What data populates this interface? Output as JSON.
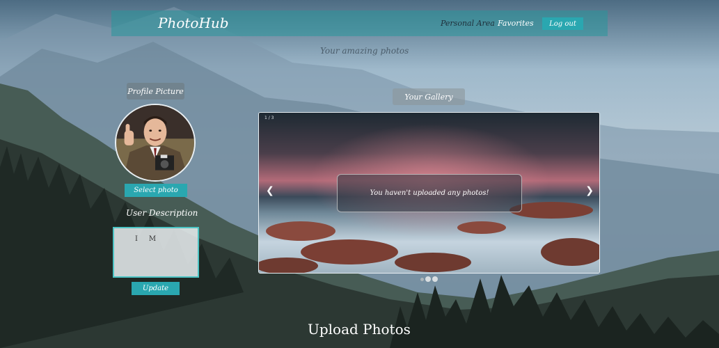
{
  "nav": {
    "brand": "PhotoHub",
    "links": [
      "Personal Area",
      "Favorites"
    ],
    "logout": "Log out"
  },
  "tagline": "Your amazing photos",
  "profile": {
    "title": "Profile Picture",
    "select_button": "Select photo",
    "description_label": "User Description",
    "description_value": "I     M",
    "update_button": "Update"
  },
  "gallery": {
    "title": "Your Gallery",
    "counter": "1 / 3",
    "prev_icon": "chevron-left-icon",
    "next_icon": "chevron-right-icon",
    "empty_message": "You haven't uploaded any photos!",
    "slides": 3,
    "active_slide": 1
  },
  "upload": {
    "title": "Upload Photos"
  },
  "colors": {
    "accent": "#2aa7b0",
    "navbar": "#28969b"
  }
}
